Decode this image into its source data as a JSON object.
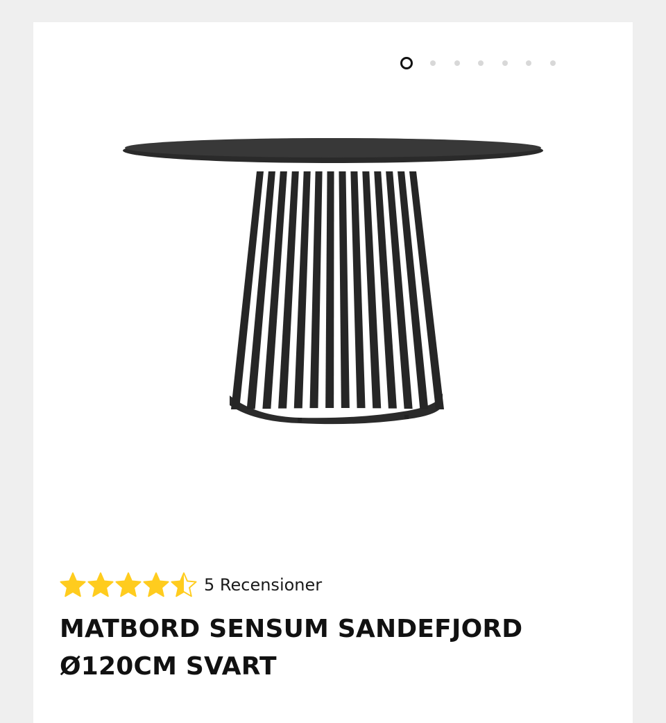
{
  "gallery": {
    "slide_count": 7,
    "active_index": 0,
    "image_alt": "icon: black round dining table with slatted pedestal base"
  },
  "rating": {
    "value": 4.5,
    "max": 5,
    "star_color": "#ffcc1e",
    "review_text": "5 Recensioner"
  },
  "product": {
    "title": "MATBORD SENSUM SANDEFJORD Ø120CM SVART"
  }
}
